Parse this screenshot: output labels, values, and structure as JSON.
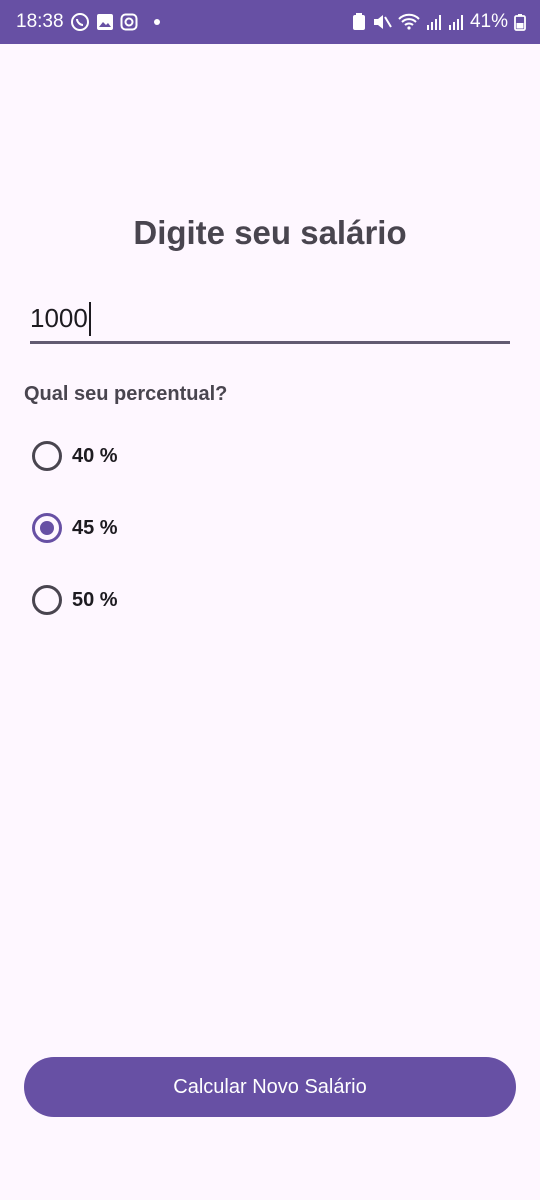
{
  "status_bar": {
    "time": "18:38",
    "notification_icons": [
      "whatsapp-icon",
      "gallery-icon",
      "instagram-icon"
    ],
    "system_icons": [
      "battery-saver-icon",
      "mute-icon",
      "wifi-icon",
      "signal-icon",
      "signal-icon"
    ],
    "battery": "41%"
  },
  "title": "Digite seu salário",
  "salary_input": {
    "value": "1000"
  },
  "percent_label": "Qual seu percentual?",
  "options": [
    {
      "label": "40 %",
      "checked": false
    },
    {
      "label": "45 %",
      "checked": true
    },
    {
      "label": "50 %",
      "checked": false
    }
  ],
  "button_label": "Calcular Novo Salário",
  "colors": {
    "primary": "#6750a4",
    "background": "#fef7ff",
    "text": "#49454f"
  }
}
